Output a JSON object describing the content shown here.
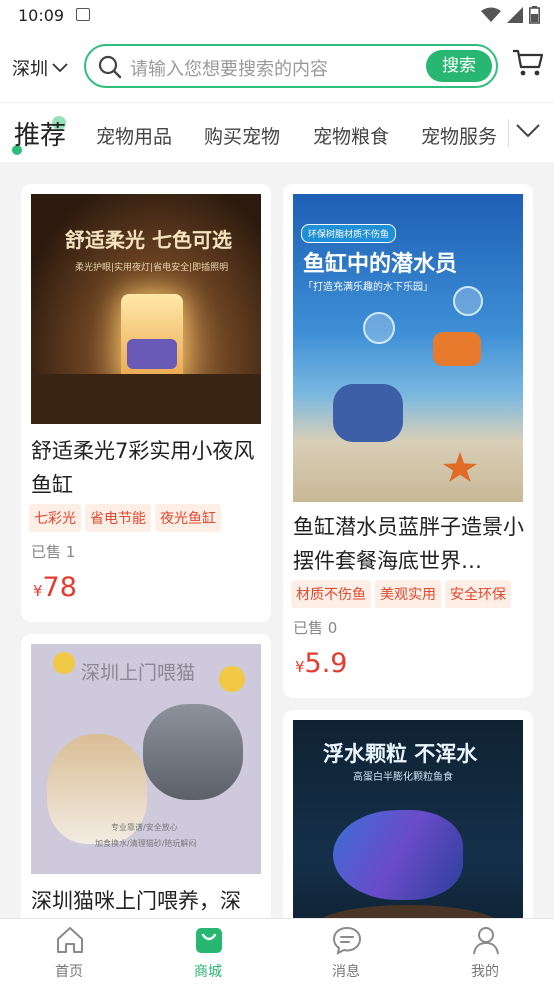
{
  "status_bar": {
    "time": "10:09"
  },
  "header": {
    "city": "深圳",
    "search_placeholder": "请输入您想要搜索的内容",
    "search_button": "搜索"
  },
  "tabs": {
    "active": "推荐",
    "items": [
      "宠物用品",
      "购买宠物",
      "宠物粮食",
      "宠物服务"
    ]
  },
  "products": [
    {
      "image_text": {
        "headline": "舒适柔光 七色可选",
        "sub": "柔光护眼|实用夜灯|省电安全|即插照明"
      },
      "title": "舒适柔光7彩实用小夜风鱼缸",
      "tags": [
        "七彩光",
        "省电节能",
        "夜光鱼缸"
      ],
      "sold": "已售 1",
      "currency": "¥",
      "price": "78"
    },
    {
      "image_text": {
        "badge": "环保树脂材质不伤鱼",
        "headline": "鱼缸中的潜水员",
        "sub": "「打造充满乐趣的水下乐园」"
      },
      "title": "鱼缸潜水员蓝胖子造景小摆件套餐海底世界…",
      "tags": [
        "材质不伤鱼",
        "美观实用",
        "安全环保"
      ],
      "sold": "已售 0",
      "currency": "¥",
      "price": "5.9"
    },
    {
      "image_text": {
        "headline": "深圳上门喂猫",
        "sub1": "专业靠谱/安全放心",
        "sub2": "加食换水/清理猫砂/陪玩解闷"
      },
      "title": "深圳猫咪上门喂养，深"
    },
    {
      "image_text": {
        "headline": "浮水颗粒 不浑水",
        "sub": "高蛋白半膨化颗粒鱼食"
      }
    }
  ],
  "bottom_nav": [
    {
      "label": "首页",
      "icon": "home-icon"
    },
    {
      "label": "商城",
      "icon": "shop-bag-icon"
    },
    {
      "label": "消息",
      "icon": "message-icon"
    },
    {
      "label": "我的",
      "icon": "user-icon"
    }
  ],
  "colors": {
    "accent": "#27b771",
    "price": "#e53b2f",
    "tag_text": "#e0482f",
    "tag_bg": "#fdeee6"
  }
}
